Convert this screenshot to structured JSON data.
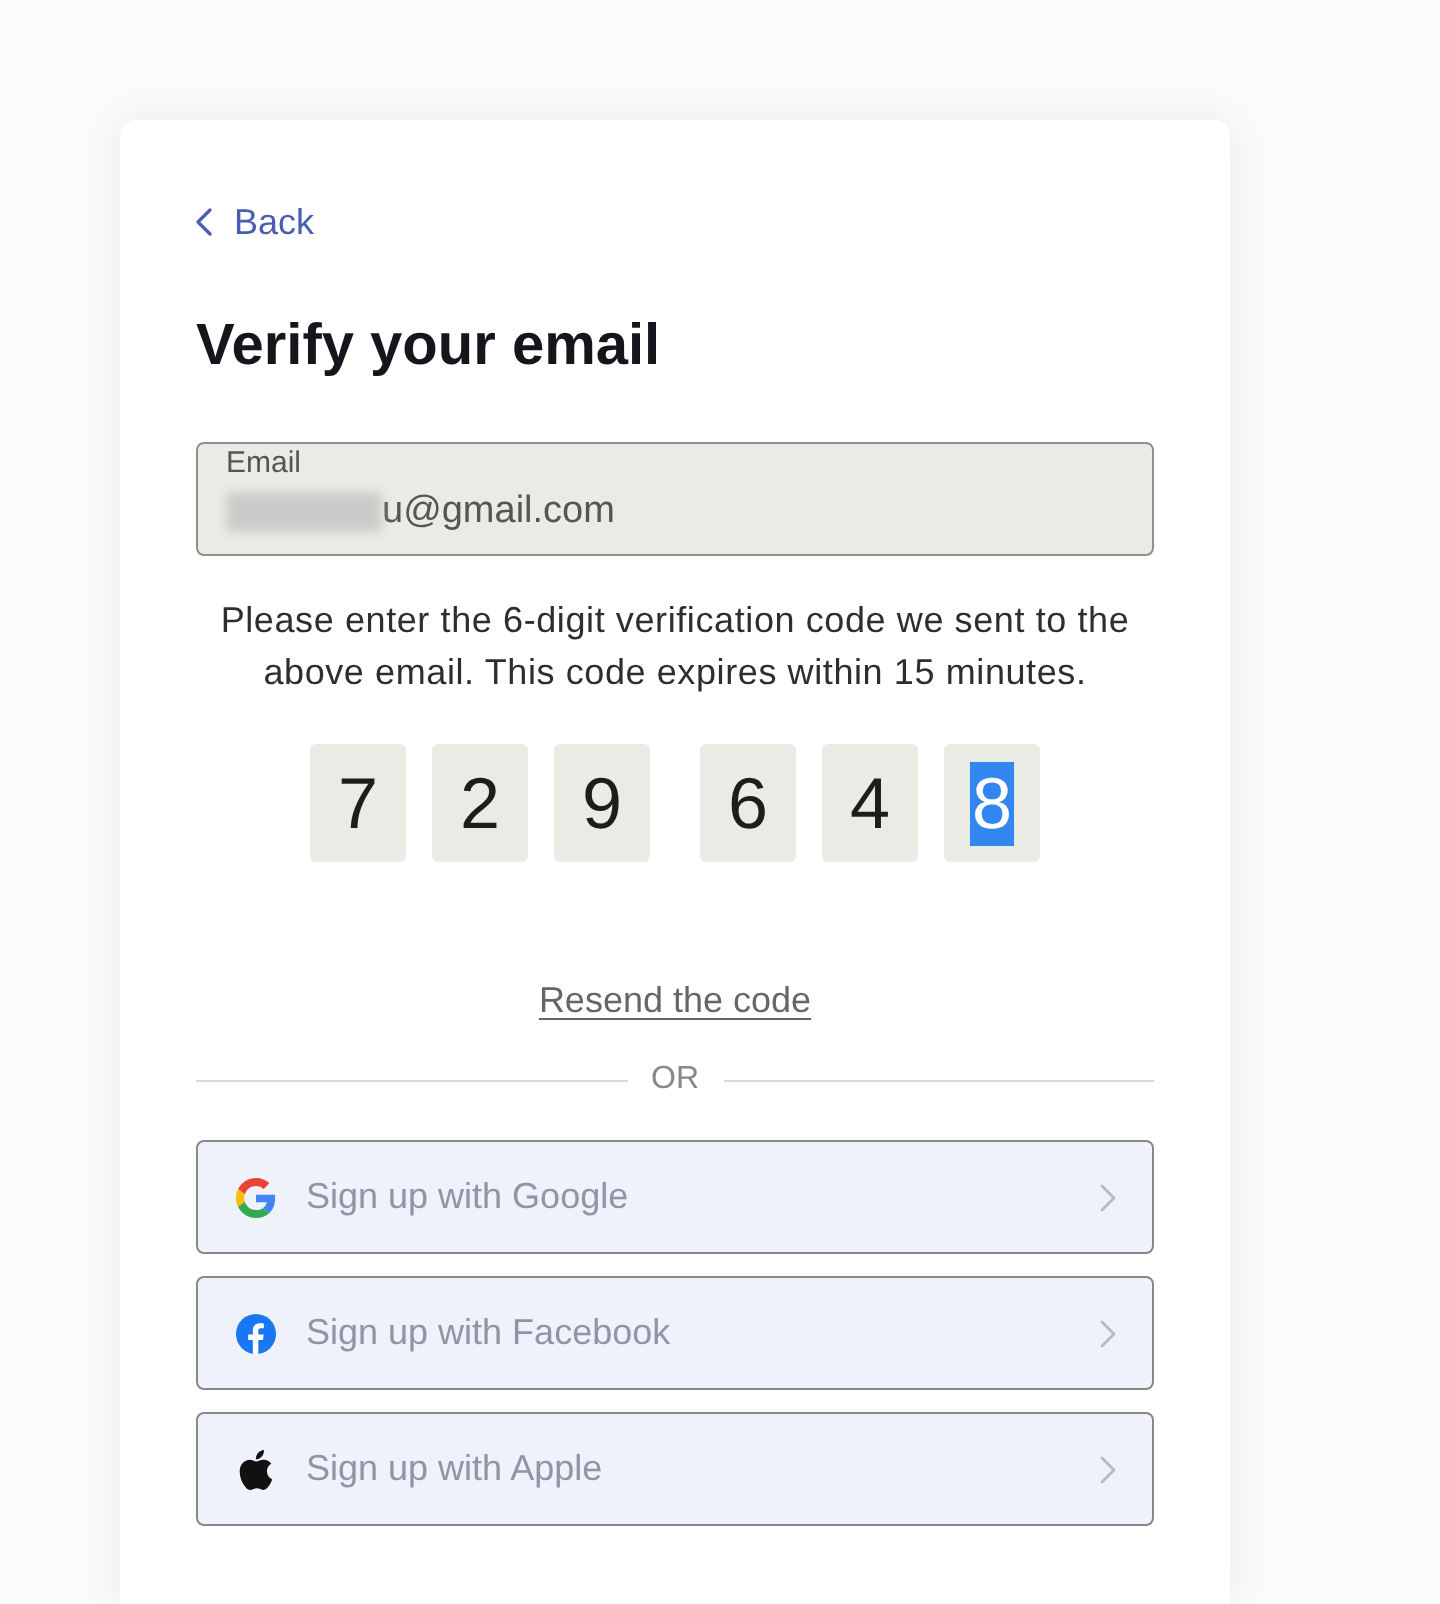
{
  "back_link": {
    "label": "Back"
  },
  "title": "Verify your email",
  "email_field": {
    "label": "Email",
    "value": "u@gmail.com",
    "redacted": true
  },
  "instructions": "Please enter the 6-digit verification code we sent to the above email. This code expires within 15 minutes.",
  "code": {
    "digits": [
      {
        "value": "7",
        "selected": false
      },
      {
        "value": "2",
        "selected": false
      },
      {
        "value": "9",
        "selected": false
      },
      {
        "value": "6",
        "selected": false
      },
      {
        "value": "4",
        "selected": false
      },
      {
        "value": "8",
        "selected": true
      }
    ]
  },
  "resend_link": {
    "label": "Resend the code"
  },
  "divider": {
    "label": "OR"
  },
  "sign_up_buttons": [
    {
      "kind": "google",
      "label": "Sign up with Google",
      "disabled": true
    },
    {
      "kind": "facebook",
      "label": "Sign up with Facebook",
      "disabled": true
    },
    {
      "kind": "apple",
      "label": "Sign up with Apple",
      "disabled": true
    }
  ]
}
